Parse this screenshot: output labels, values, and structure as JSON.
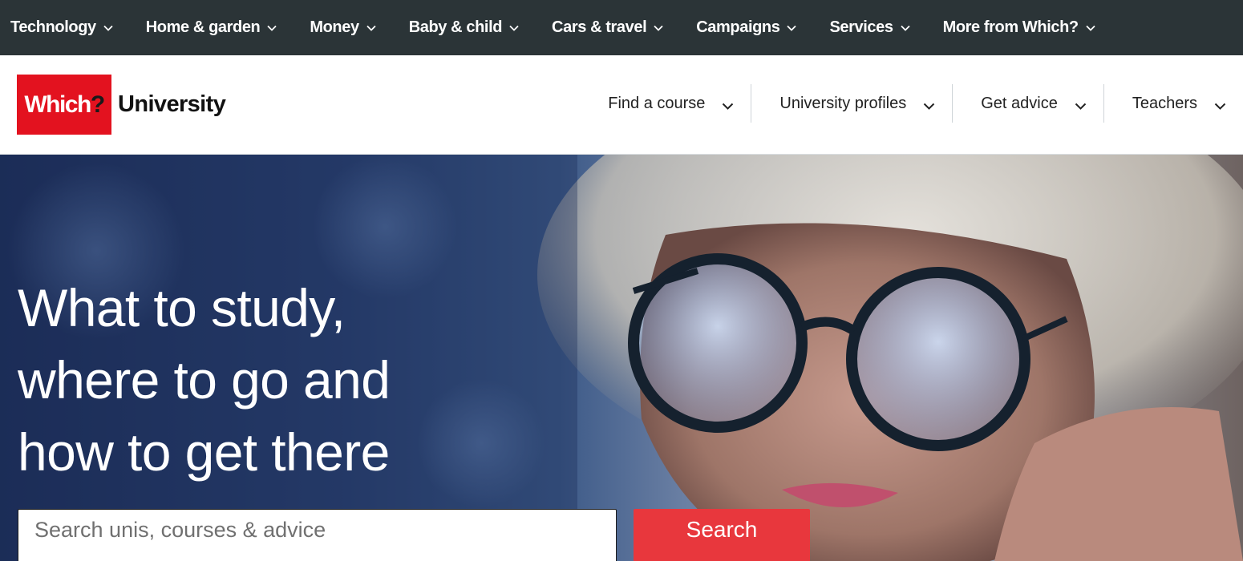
{
  "topnav": {
    "items": [
      {
        "label": "Technology"
      },
      {
        "label": "Home & garden"
      },
      {
        "label": "Money"
      },
      {
        "label": "Baby & child"
      },
      {
        "label": "Cars & travel"
      },
      {
        "label": "Campaigns"
      },
      {
        "label": "Services"
      },
      {
        "label": "More from Which?"
      }
    ]
  },
  "header": {
    "logo_mark": "Which",
    "logo_mark_q": "?",
    "logo_text": "University",
    "subnav": [
      {
        "label": "Find a course"
      },
      {
        "label": "University profiles"
      },
      {
        "label": "Get advice"
      },
      {
        "label": "Teachers"
      }
    ]
  },
  "hero": {
    "title_line1": "What to study,",
    "title_line2": "where to go and",
    "title_line3": "how to get there",
    "search_placeholder": "Search unis, courses & advice",
    "search_button": "Search"
  },
  "colors": {
    "topnav_bg": "#2b3437",
    "brand_red": "#e3121f",
    "search_button": "#e8373d"
  },
  "icons": [
    "chevron-down-icon"
  ]
}
